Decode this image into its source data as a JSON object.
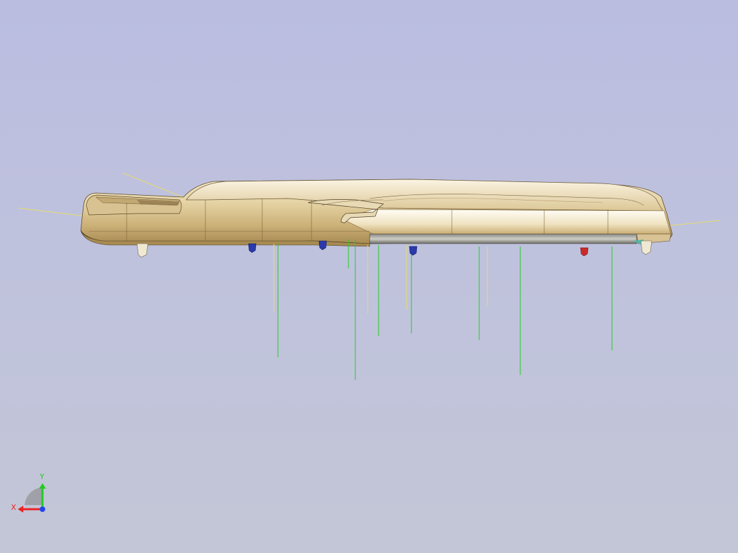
{
  "viewport": {
    "background_top": "#babde0",
    "background_bottom": "#c3c6d6"
  },
  "model": {
    "body_color": "#d9c394",
    "highlight_color": "#f4ebd3",
    "shadow_color": "#b59a64",
    "edge_color": "#4a3a20",
    "dim_line_color_yellow": "#e8e070",
    "dim_line_color_green": "#22cc22",
    "pin_colors": [
      "#e8e0c8",
      "#2233aa",
      "#2233aa",
      "#2233aa",
      "#cc2222",
      "#e8e0c8"
    ]
  },
  "triad": {
    "x_label": "X",
    "y_label": "Y",
    "x_color": "#ee2222",
    "y_color": "#22cc22",
    "z_color": "#2244ee",
    "icon": "axis-triad-icon"
  }
}
